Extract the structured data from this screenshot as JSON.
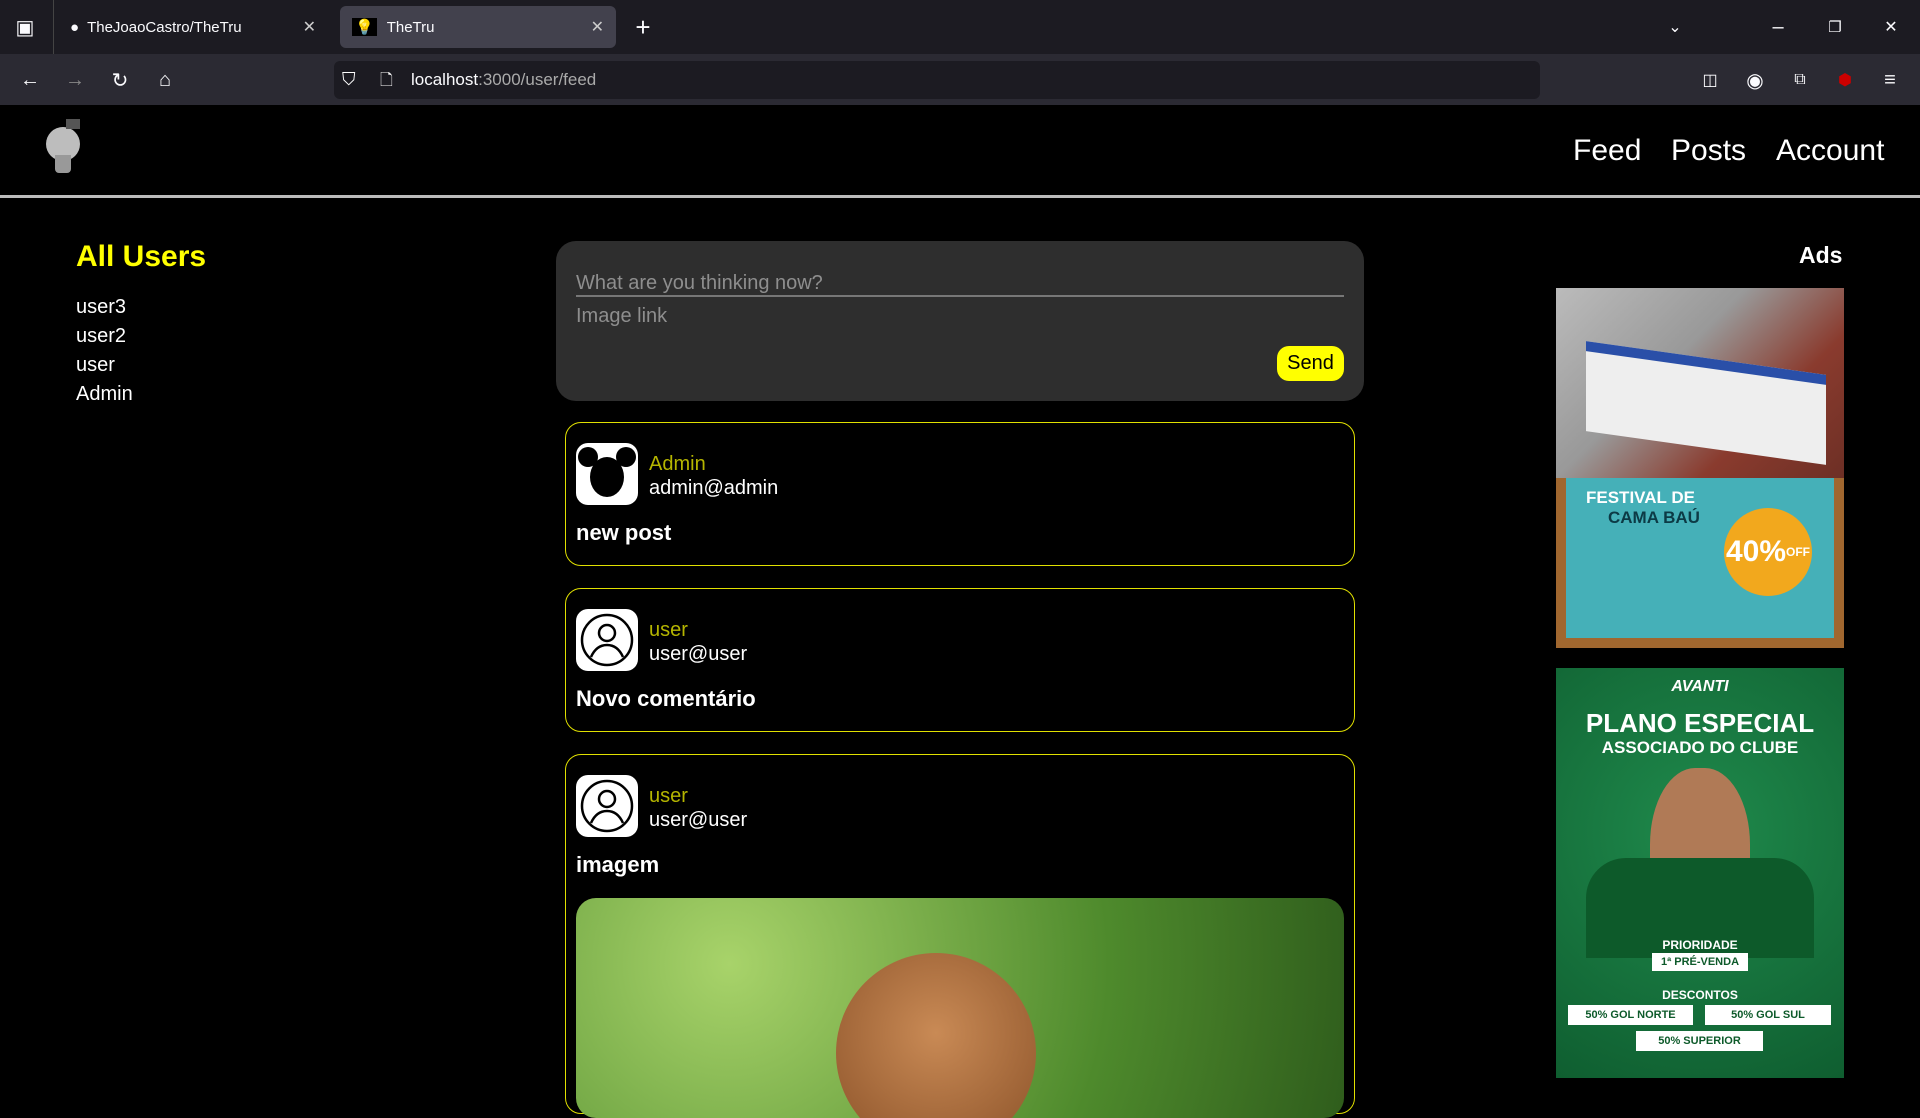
{
  "browser": {
    "tabs": [
      {
        "title": "TheJoaoCastro/TheTru",
        "icon": "github-icon"
      },
      {
        "title": "TheTru",
        "icon": "bulb-favicon",
        "active": true
      }
    ],
    "url_host": "localhost",
    "url_path": ":3000/user/feed"
  },
  "header": {
    "logo": "lightbulb-logo",
    "nav": [
      "Feed",
      "Posts",
      "Account"
    ]
  },
  "sidebar": {
    "title": "All Users",
    "users": [
      "user3",
      "user2",
      "user",
      "Admin"
    ]
  },
  "composer": {
    "text_placeholder": "What are you thinking now?",
    "image_placeholder": "Image link",
    "send_label": "Send"
  },
  "posts": [
    {
      "name": "Admin",
      "email": "admin@admin",
      "title": "new post",
      "avatar": "mickey-avatar"
    },
    {
      "name": "user",
      "email": "user@user",
      "title": "Novo comentário",
      "avatar": "default-user-avatar"
    },
    {
      "name": "user",
      "email": "user@user",
      "title": "imagem",
      "avatar": "default-user-avatar",
      "image": "proboscis-monkey-photo"
    }
  ],
  "ads": {
    "title": "Ads",
    "ad1": {
      "line1": "FESTIVAL DE",
      "line2": "CAMA BAÚ",
      "badge": "40%",
      "badge_sub": "OFF"
    },
    "ad2": {
      "brand": "AVANTI",
      "line1": "PLANO ESPECIAL",
      "line2": "ASSOCIADO DO CLUBE",
      "priority": "PRIORIDADE",
      "presale": "1ª PRÉ-VENDA",
      "discounts": "DESCONTOS",
      "d1": "50% GOL NORTE",
      "d2": "50% GOL SUL",
      "d3": "50% SUPERIOR"
    }
  },
  "colors": {
    "accent": "#ffff00",
    "name": "#b5b500",
    "composer_bg": "#2e2e2e"
  }
}
